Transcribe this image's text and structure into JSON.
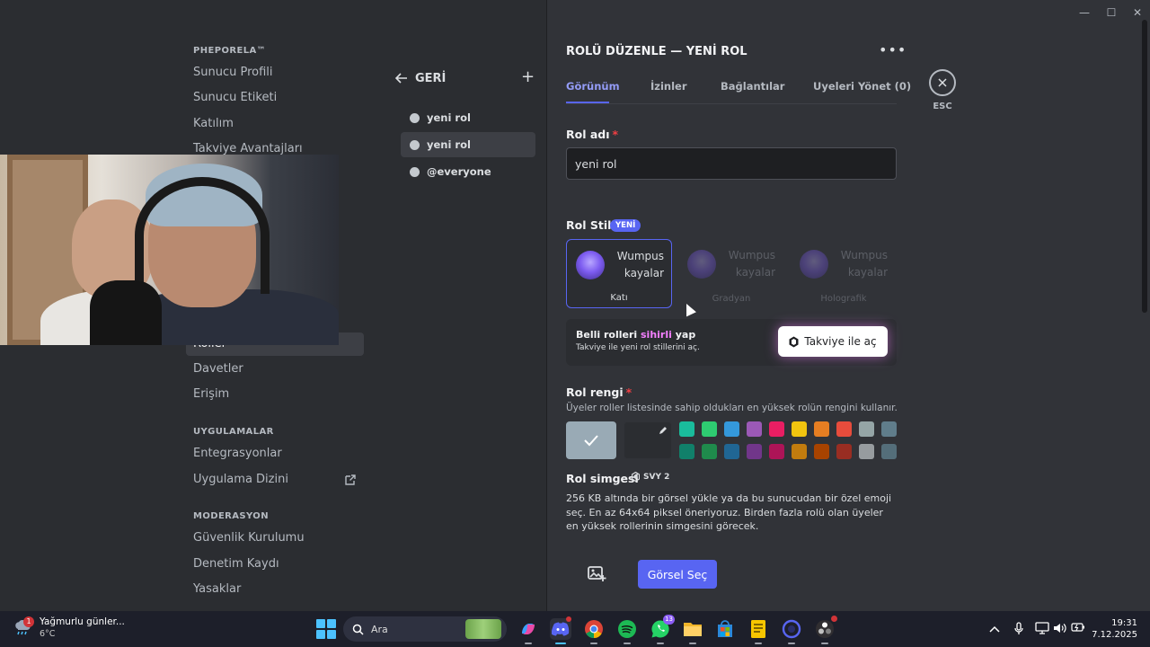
{
  "window": {
    "controls": {
      "minimize": "—",
      "maximize": "☐",
      "close": "✕"
    }
  },
  "sidebar": {
    "server_header": "PHEPORELA™",
    "items_top": [
      {
        "label": "Sunucu Profili"
      },
      {
        "label": "Sunucu Etiketi"
      },
      {
        "label": "Katılım"
      },
      {
        "label": "Takviye Avantajları"
      }
    ],
    "items_mid": [
      {
        "label": "Roller",
        "selected": true
      },
      {
        "label": "Davetler"
      },
      {
        "label": "Erişim"
      }
    ],
    "apps_header": "UYGULAMALAR",
    "apps_items": [
      {
        "label": "Entegrasyonlar"
      },
      {
        "label": "Uygulama Dizini",
        "external": true
      }
    ],
    "moderation_header": "MODERASYON",
    "moderation_items": [
      {
        "label": "Güvenlik Kurulumu"
      },
      {
        "label": "Denetim Kaydı"
      },
      {
        "label": "Yasaklar"
      }
    ]
  },
  "roles_list": {
    "back_label": "GERİ",
    "add_symbol": "+",
    "roles": [
      {
        "label": "yeni rol",
        "selected": false
      },
      {
        "label": "yeni rol",
        "selected": true
      },
      {
        "label": "@everyone",
        "selected": false
      }
    ]
  },
  "editor": {
    "title": "ROLÜ DÜZENLE — YENİ ROL",
    "more_symbol": "•••",
    "tabs": [
      {
        "label": "Görünüm",
        "active": true
      },
      {
        "label": "İzinler"
      },
      {
        "label": "Bağlantılar"
      },
      {
        "label": "Uyeleri Yönet (0)"
      }
    ],
    "esc_label": "ESC",
    "role_name": {
      "label": "Rol adı",
      "required_mark": "*",
      "value": "yeni rol"
    },
    "role_style": {
      "label": "Rol Stili",
      "badge": "YENİ",
      "options": [
        {
          "preview_line1": "Wumpus",
          "preview_line2": "kayalar",
          "caption": "Katı",
          "selected": true
        },
        {
          "preview_line1": "Wumpus",
          "preview_line2": "kayalar",
          "caption": "Gradyan"
        },
        {
          "preview_line1": "Wumpus",
          "preview_line2": "kayalar",
          "caption": "Holografik"
        }
      ]
    },
    "boost_promo": {
      "title_prefix": "Belli rolleri ",
      "title_magic": "sihirli",
      "title_suffix": " yap",
      "subtitle": "Takviye ile yeni rol stillerini aç.",
      "button_label": "Takviye ile aç"
    },
    "role_color": {
      "label": "Rol rengi",
      "required_mark": "*",
      "hint": "Üyeler roller listesinde sahip oldukları en yüksek rolün rengini kullanır.",
      "default_color": "#99aab5",
      "swatches_row1": [
        "#1abc9c",
        "#2ecc71",
        "#3498db",
        "#9b59b6",
        "#e91e63",
        "#f1c40f",
        "#e67e22",
        "#e74c3c",
        "#95a5a6",
        "#607d8b"
      ],
      "swatches_row2": [
        "#11806a",
        "#1f8b4c",
        "#206694",
        "#71368a",
        "#ad1457",
        "#c27c0e",
        "#a84300",
        "#992d22",
        "#979c9f",
        "#546e7a"
      ]
    },
    "role_icon": {
      "label": "Rol simgesi",
      "level_badge": "SVY 2",
      "description": "256 KB altında bir görsel yükle ya da bu sunucudan bir özel emoji seç. En az 64x64 piksel öneriyoruz. Birden fazla rolü olan üyeler en yüksek rollerinin simgesini görecek.",
      "select_button": "Görsel Seç"
    },
    "colors": {
      "accent": "#5865f2",
      "active_tab": "#949cf7",
      "required": "#f23f43",
      "magic": "#f47fff"
    }
  },
  "taskbar": {
    "weather": {
      "title": "Yağmurlu günler...",
      "temp": "6°C",
      "badge": "1"
    },
    "search_label": "Ara",
    "apps": [
      {
        "name": "copilot-icon"
      },
      {
        "name": "discord-icon",
        "active": true
      },
      {
        "name": "chrome-icon"
      },
      {
        "name": "spotify-icon"
      },
      {
        "name": "whatsapp-icon",
        "badge": "13"
      },
      {
        "name": "file-explorer-icon"
      },
      {
        "name": "microsoft-store-icon"
      },
      {
        "name": "notes-icon"
      },
      {
        "name": "app-circle-icon"
      },
      {
        "name": "obs-icon"
      }
    ],
    "clock": {
      "time": "19:31",
      "date": "7.12.2025"
    }
  }
}
